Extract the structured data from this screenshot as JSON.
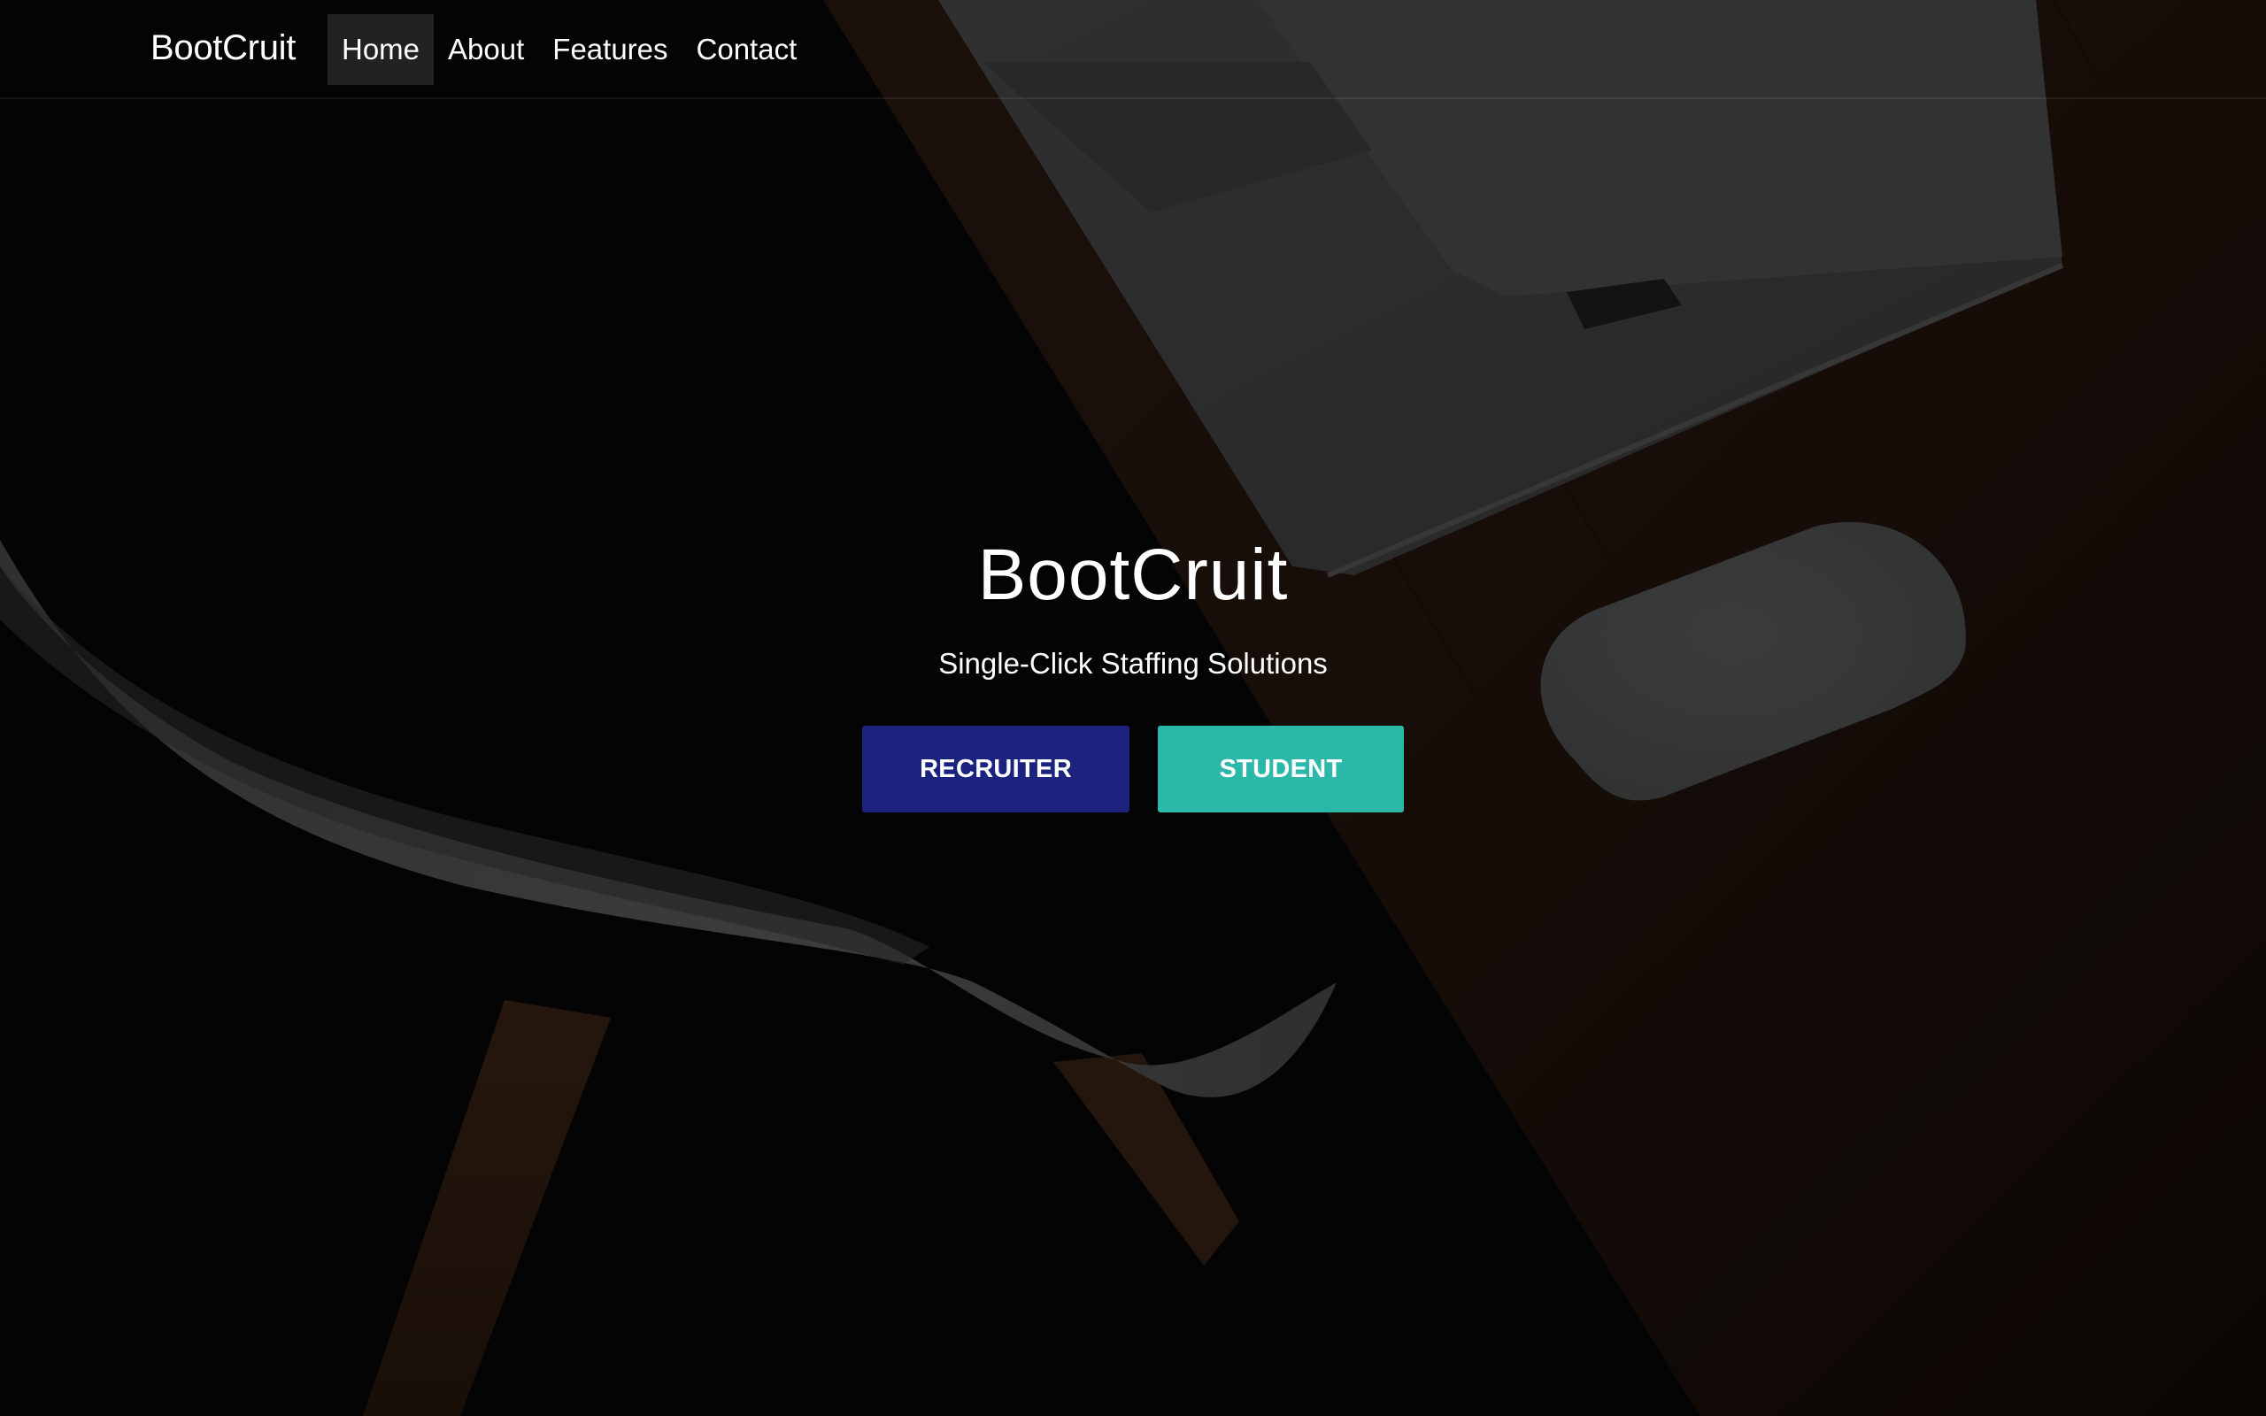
{
  "navbar": {
    "brand": "BootCruit",
    "links": [
      {
        "label": "Home",
        "active": true
      },
      {
        "label": "About",
        "active": false
      },
      {
        "label": "Features",
        "active": false
      },
      {
        "label": "Contact",
        "active": false
      }
    ]
  },
  "hero": {
    "title": "BootCruit",
    "tagline": "Single-Click Staffing Solutions",
    "buttons": {
      "recruiter": "RECRUITER",
      "student": "STUDENT"
    }
  },
  "colors": {
    "recruiter_button": "#1b237f",
    "student_button": "#2bb8a8",
    "overlay": "#000000"
  },
  "background_image": "desk-with-laptop-mouse-and-white-chair"
}
